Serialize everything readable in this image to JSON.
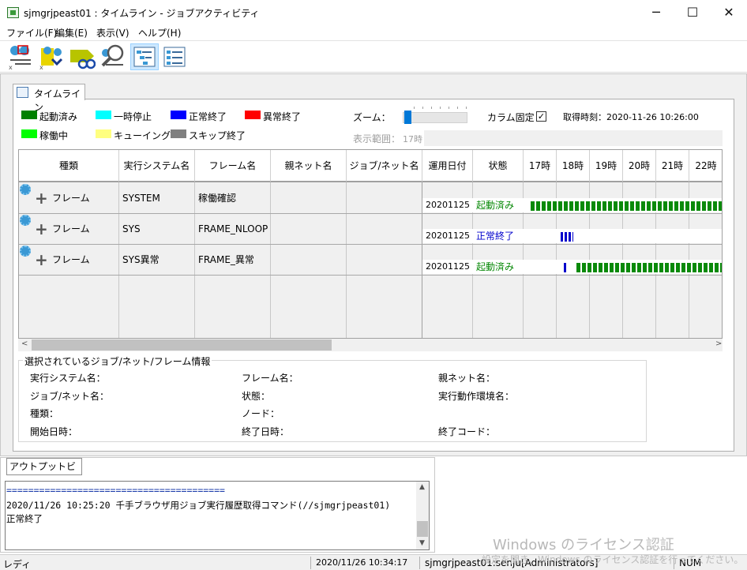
{
  "window": {
    "title": "sjmgrjpeast01 : タイムライン - ジョブアクティビティ",
    "minimize": "─",
    "maximize": "☐",
    "close": "✕"
  },
  "menu": [
    "ファイル(F)",
    "編集(E)",
    "表示(V)",
    "ヘルプ(H)"
  ],
  "toolbar": {
    "icons": [
      "job-net-list-icon",
      "job-refresh-icon",
      "sort-icon",
      "search-icon",
      "timeline-view-icon",
      "list-view-icon"
    ],
    "selected": "timeline-view-icon"
  },
  "tab": {
    "label": "タイムライン"
  },
  "legend": [
    {
      "label": "起動済み",
      "color": "#008000"
    },
    {
      "label": "一時停止",
      "color": "#00ffff"
    },
    {
      "label": "正常終了",
      "color": "#0000ff"
    },
    {
      "label": "異常終了",
      "color": "#ff0000"
    },
    {
      "label": "稼働中",
      "color": "#00ff00"
    },
    {
      "label": "キューイング",
      "color": "#ffff80"
    },
    {
      "label": "スキップ終了",
      "color": "#808080"
    }
  ],
  "zoom": {
    "label": "ズーム："
  },
  "column_fix": {
    "label": "カラム固定",
    "checked": true
  },
  "acquired": {
    "label": "取得時刻：2020-11-26 10:26:00"
  },
  "display_range": {
    "label": "表示範囲：",
    "value": "17時"
  },
  "table": {
    "headers": [
      "種類",
      "実行システム名",
      "フレーム名",
      "親ネット名",
      "ジョブ/ネット名",
      "運用日付",
      "状態"
    ],
    "hours": [
      "17時",
      "18時",
      "19時",
      "20時",
      "21時",
      "22時"
    ],
    "rows": [
      {
        "type": "フレーム",
        "system": "SYSTEM",
        "frame": "稼働確認",
        "parent": "",
        "job": "",
        "date": "20201125",
        "status": "起動済み",
        "status_color": "#0a8a0a"
      },
      {
        "type": "フレーム",
        "system": "SYS",
        "frame": "FRAME_NLOOP",
        "parent": "",
        "job": "",
        "date": "20201125",
        "status": "正常終了",
        "status_color": "#0000cc"
      },
      {
        "type": "フレーム",
        "system": "SYS異常",
        "frame": "FRAME_異常",
        "parent": "",
        "job": "",
        "date": "20201125",
        "status": "起動済み",
        "status_color": "#0a8a0a"
      }
    ]
  },
  "info": {
    "title": "選択されているジョブ/ネット/フレーム情報",
    "labels": [
      "実行システム名：",
      "フレーム名：",
      "親ネット名：",
      "ジョブ/ネット名：",
      "状態：",
      "実行動作環境名：",
      "種類：",
      "ノード：",
      "開始日時：",
      "終了日時：",
      "終了コード："
    ]
  },
  "output": {
    "tab": "アウトプットビュー",
    "lines": [
      "========================================",
      "2020/11/26 10:25:20 千手ブラウザ用ジョブ実行履歴取得コマンド(//sjmgrjpeast01)",
      "正常終了"
    ]
  },
  "status": {
    "ready": "レディ",
    "datetime": "2020/11/26 10:34:17",
    "user": "sjmgrjpeast01:senju[Administrators]",
    "num": "NUM"
  },
  "watermark": {
    "line1": "Windows のライセンス認証",
    "line2": "設定を開き、Windows のライセンス認証を行ってください。"
  }
}
